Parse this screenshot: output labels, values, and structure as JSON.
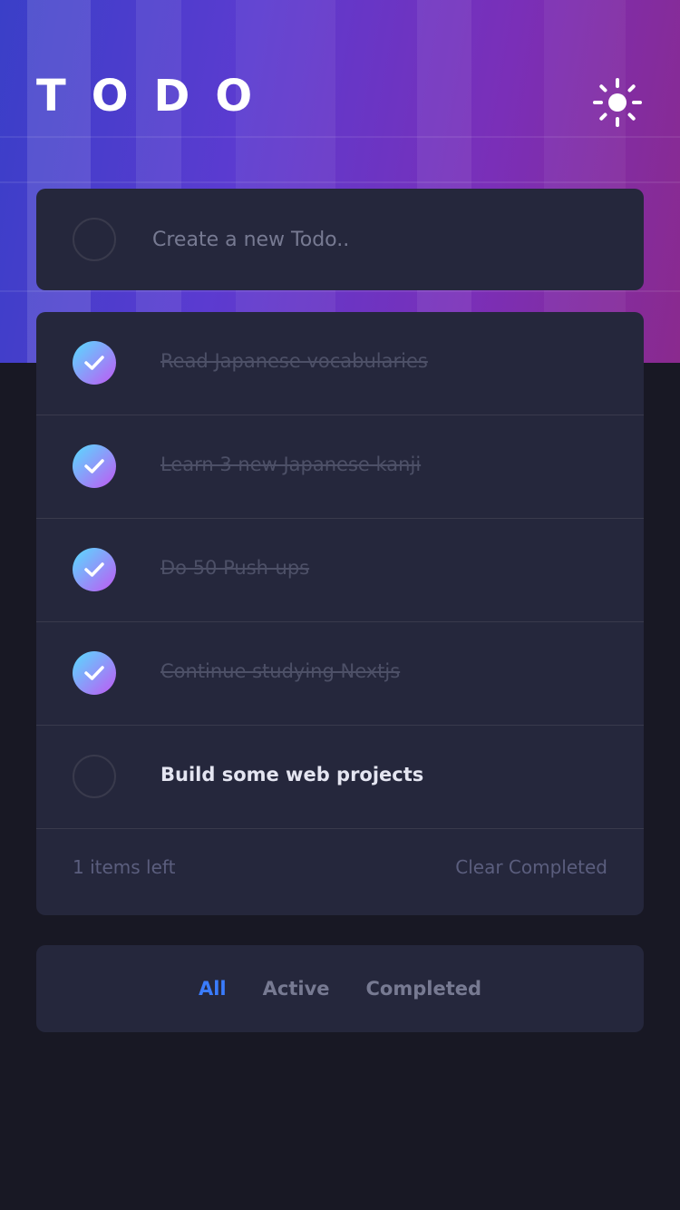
{
  "header": {
    "title": "TODO",
    "theme_toggle_icon": "sun-icon"
  },
  "new_todo": {
    "placeholder": "Create a new Todo.."
  },
  "todos": [
    {
      "text": "Read Japanese vocabularies",
      "completed": true
    },
    {
      "text": "Learn 3 new Japanese kanji",
      "completed": true
    },
    {
      "text": "Do 50 Push-ups",
      "completed": true
    },
    {
      "text": "Continue studying Nextjs",
      "completed": true
    },
    {
      "text": "Build some web projects",
      "completed": false
    }
  ],
  "footer": {
    "items_left": "1 items left",
    "clear_completed": "Clear Completed"
  },
  "filters": {
    "all": "All",
    "active": "Active",
    "completed": "Completed",
    "selected": "All"
  },
  "colors": {
    "accent": "#3a7cfd",
    "check_gradient_start": "#57ddff",
    "check_gradient_end": "#c058f3",
    "card_bg": "#25273c",
    "page_bg": "#181824"
  }
}
